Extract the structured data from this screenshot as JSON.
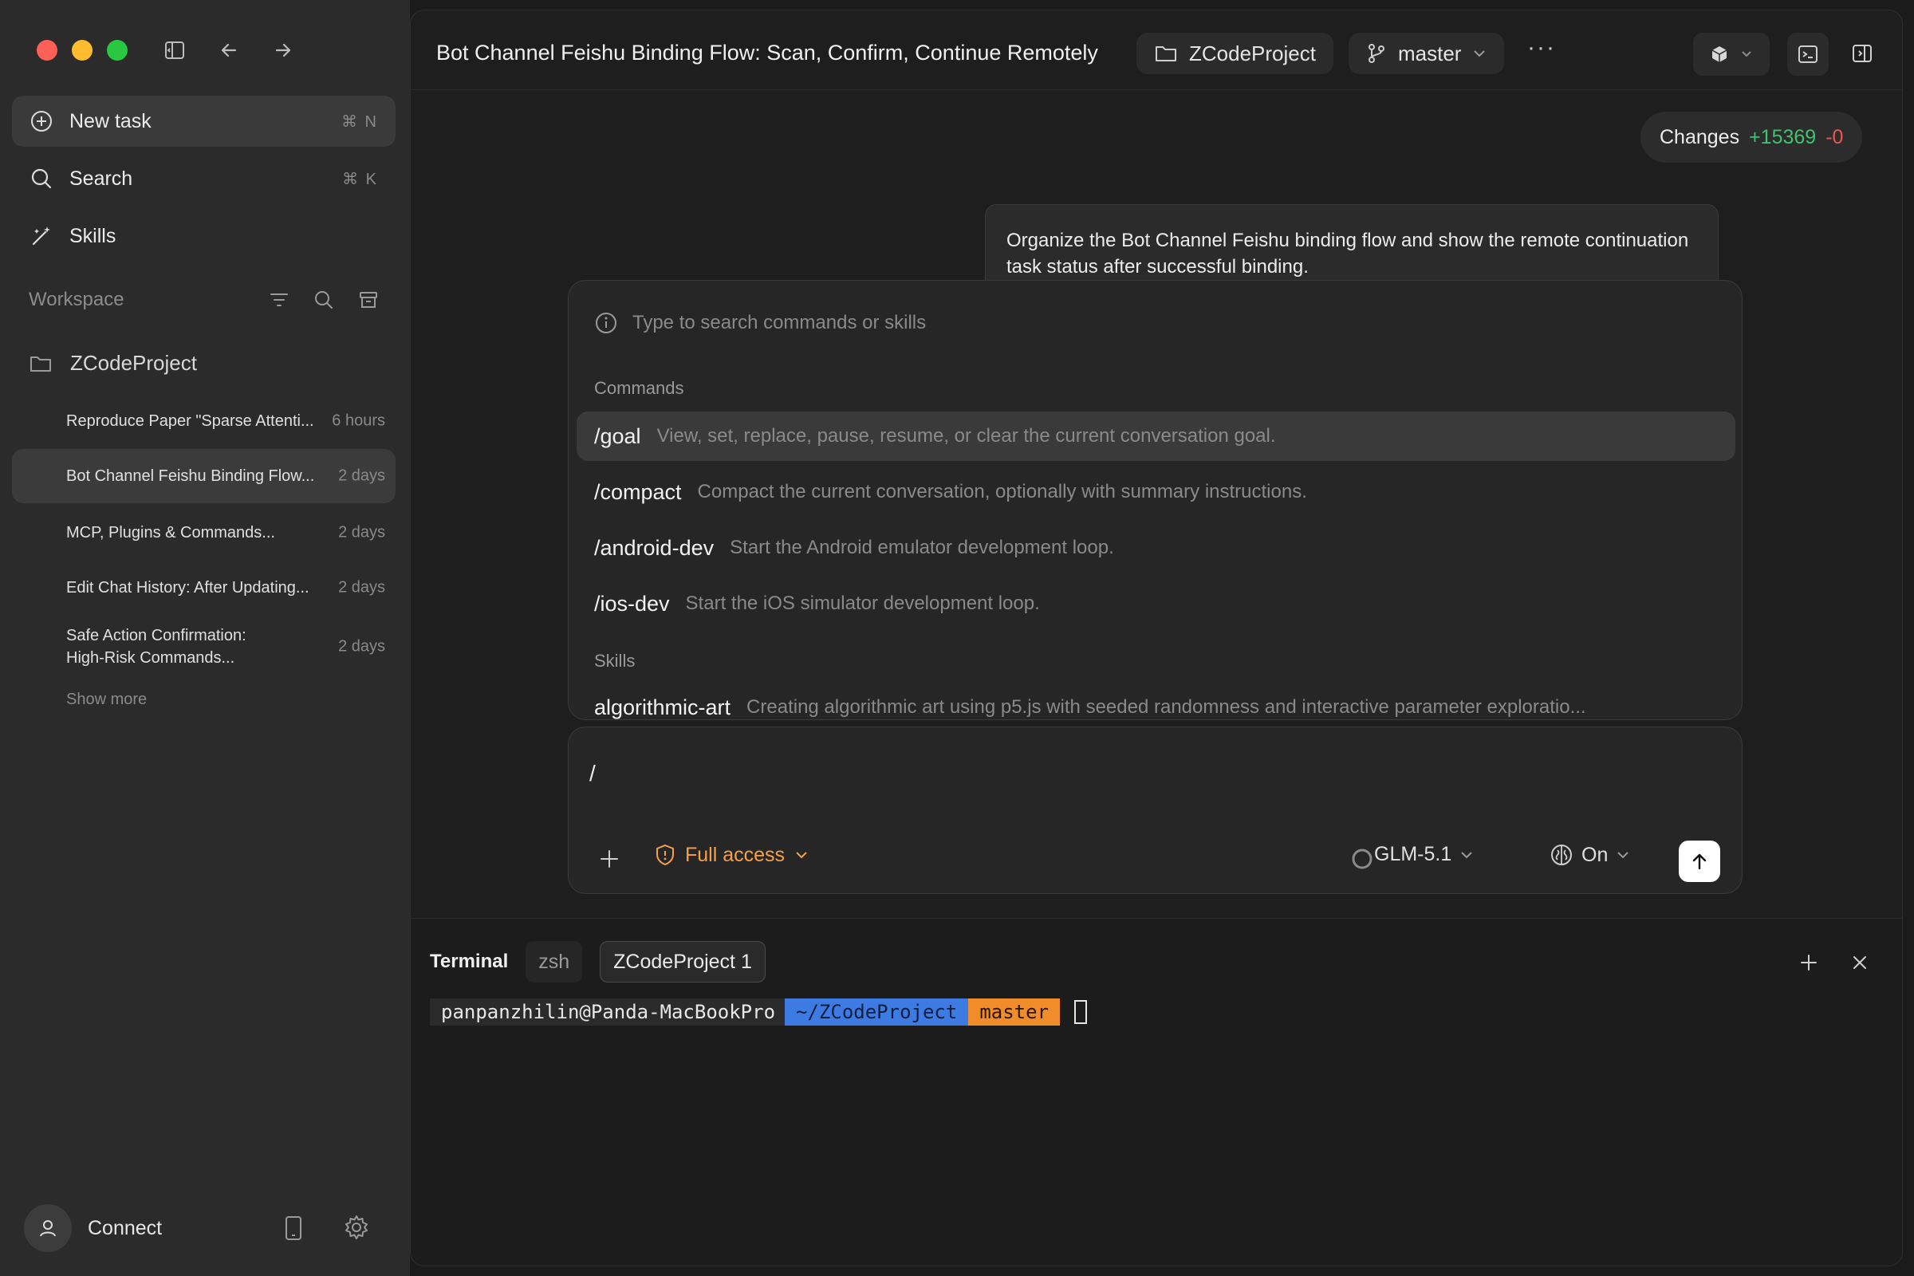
{
  "sidebar": {
    "new_task": {
      "label": "New task",
      "shortcut": "⌘ N"
    },
    "search": {
      "label": "Search",
      "shortcut": "⌘ K"
    },
    "skills": {
      "label": "Skills"
    },
    "workspace_label": "Workspace",
    "project": "ZCodeProject",
    "tasks": [
      {
        "title": "Reproduce Paper \"Sparse Attenti...",
        "age": "6 hours"
      },
      {
        "title": "Bot Channel Feishu Binding Flow...",
        "age": "2 days"
      },
      {
        "title": "MCP,  Plugins & Commands...",
        "age": "2 days"
      },
      {
        "title": "Edit Chat History: After Updating...",
        "age": "2 days"
      },
      {
        "title_line1": "Safe Action Confirmation:",
        "title_line2": "High-Risk Commands...",
        "age": "2 days"
      }
    ],
    "show_more": "Show more",
    "connect": "Connect"
  },
  "header": {
    "title": "Bot Channel Feishu Binding Flow: Scan, Confirm, Continue Remotely",
    "project": "ZCodeProject",
    "branch": "master",
    "more": "···"
  },
  "changes": {
    "label": "Changes",
    "added": "+15369",
    "removed": "-0"
  },
  "user_message": "Organize the Bot Channel Feishu binding flow and show the remote continuation task status after successful binding.",
  "command_palette": {
    "placeholder": "Type to search commands or skills",
    "commands_label": "Commands",
    "commands": [
      {
        "name": "/goal",
        "desc": "View, set, replace, pause, resume, or clear the current conversation goal."
      },
      {
        "name": "/compact",
        "desc": "Compact the current conversation, optionally with summary instructions."
      },
      {
        "name": "/android-dev",
        "desc": "Start the Android emulator development loop."
      },
      {
        "name": "/ios-dev",
        "desc": "Start the iOS simulator development loop."
      }
    ],
    "skills_label": "Skills",
    "skills": [
      {
        "name": "algorithmic-art",
        "desc": "Creating algorithmic art using p5.js with seeded randomness and interactive parameter exploratio..."
      }
    ]
  },
  "composer": {
    "input_value": "/",
    "access": "Full access",
    "model": "GLM-5.1",
    "thinking": "On"
  },
  "terminal": {
    "label": "Terminal",
    "tabs": [
      "zsh",
      "ZCodeProject 1"
    ],
    "user_host": "panpanzhilin@Panda-MacBookPro",
    "path": "~/ZCodeProject",
    "branch": "master"
  },
  "colors": {
    "accent_orange": "#f5a04a",
    "added_green": "#3ec46d",
    "removed_red": "#f05454",
    "path_blue": "#3d7be3",
    "branch_orange": "#f08d2a"
  }
}
